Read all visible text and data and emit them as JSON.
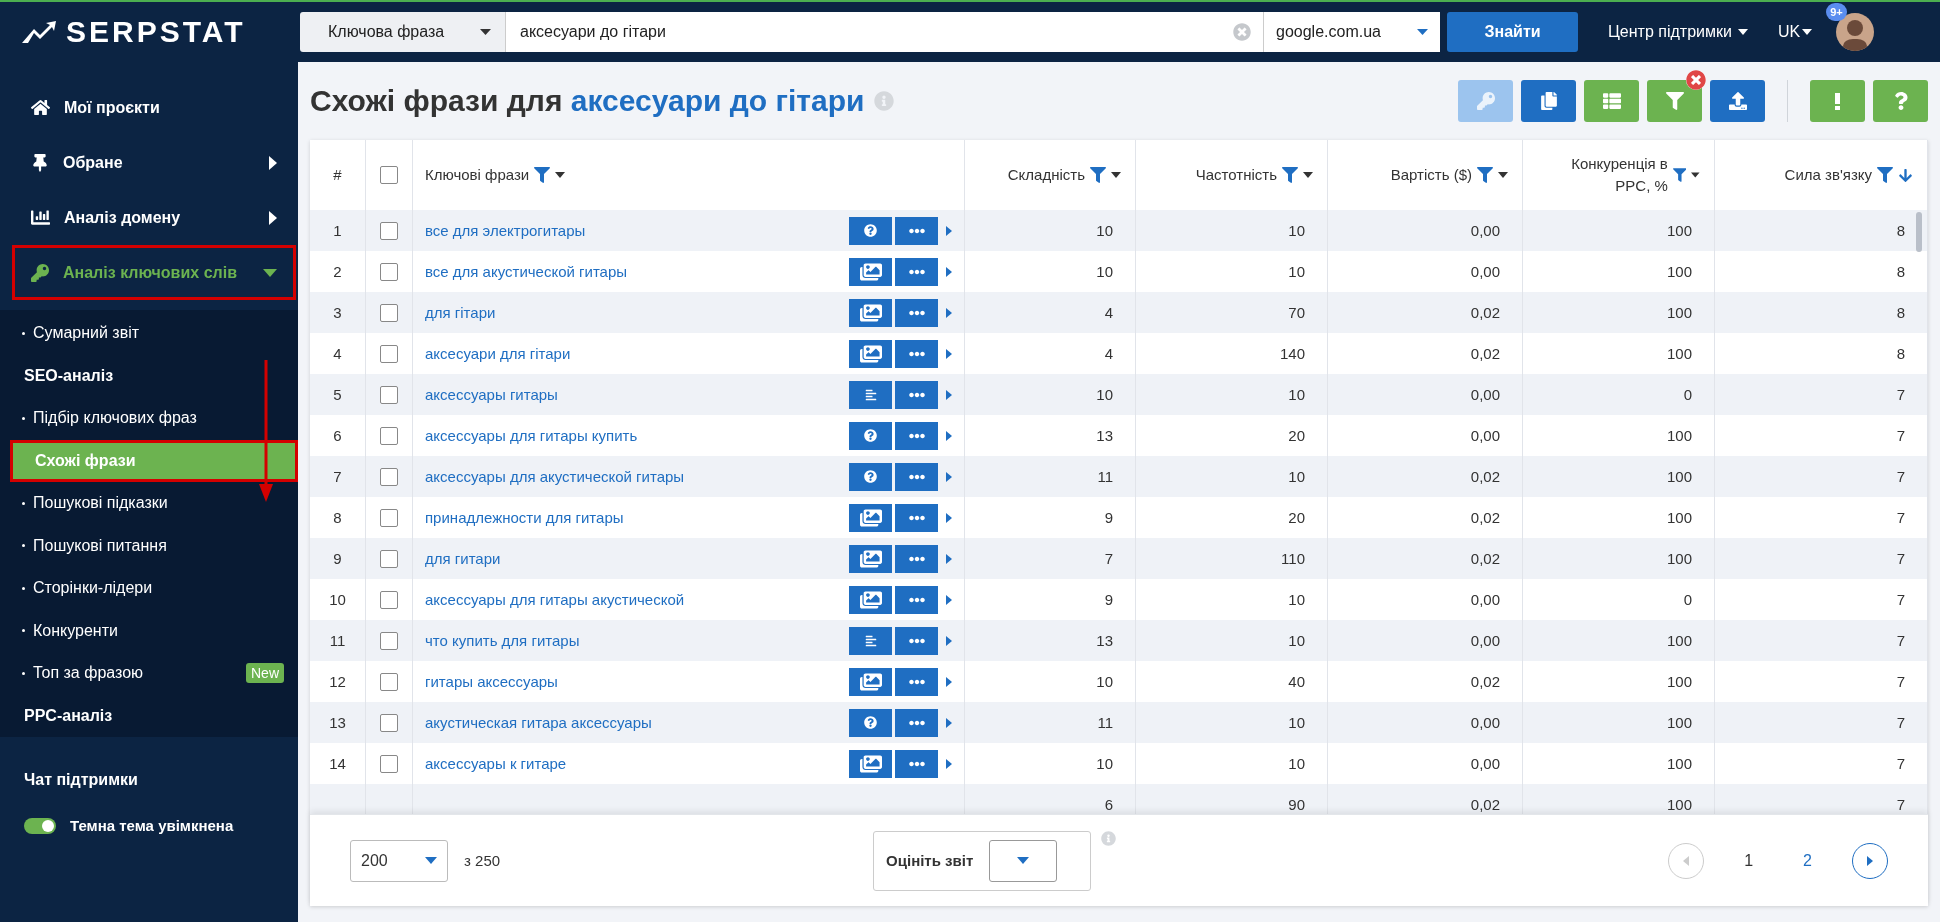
{
  "logo": {
    "text": "SERPSTAT"
  },
  "search": {
    "type_select": "Ключова фраза",
    "query": "аксесуари до гітари",
    "engine_select": "google.com.ua",
    "submit": "Знайти"
  },
  "header": {
    "support": "Центр підтримки",
    "language": "UK",
    "notifications": "9+"
  },
  "sidebar": {
    "items": [
      {
        "label": "Мої проєкти",
        "kind": "home",
        "submenu": false,
        "expanded": false,
        "annotated": false
      },
      {
        "label": "Обране",
        "kind": "pin",
        "submenu": true,
        "expanded": false,
        "annotated": false
      },
      {
        "label": "Аналіз домену",
        "kind": "chart",
        "submenu": true,
        "expanded": false,
        "annotated": false
      },
      {
        "label": "Аналіз ключових слів",
        "kind": "key",
        "submenu": true,
        "expanded": true,
        "annotated": true
      }
    ],
    "subitems": [
      {
        "label": "Сумарний звіт",
        "kind": "link",
        "selected": false,
        "annotated": false
      },
      {
        "label": "SEO-аналіз",
        "kind": "heading"
      },
      {
        "label": "Підбір ключових фраз",
        "kind": "link",
        "selected": false,
        "annotated": false
      },
      {
        "label": "Схожі фрази",
        "kind": "link",
        "selected": true,
        "annotated": true
      },
      {
        "label": "Пошукові підказки",
        "kind": "link",
        "selected": false,
        "annotated": false
      },
      {
        "label": "Пошукові питання",
        "kind": "link",
        "selected": false,
        "annotated": false
      },
      {
        "label": "Сторінки-лідери",
        "kind": "link",
        "selected": false,
        "annotated": false
      },
      {
        "label": "Конкуренти",
        "kind": "link",
        "selected": false,
        "annotated": false
      },
      {
        "label": "Топ за фразою",
        "kind": "link",
        "selected": false,
        "annotated": false,
        "badge": "New"
      },
      {
        "label": "PPC-аналіз",
        "kind": "heading"
      }
    ],
    "chat": "Чат підтримки",
    "theme_toggle": {
      "label": "Темна тема увімкнена",
      "on": true
    }
  },
  "page": {
    "title": "Схожі фрази для",
    "query": "аксесуари до гітари"
  },
  "toolbar": [
    {
      "kind": "key",
      "color": "#9cc4ee",
      "badge": false,
      "disabled": true
    },
    {
      "kind": "copy",
      "color": "#1f6ec2",
      "badge": false,
      "disabled": false
    },
    {
      "kind": "columns",
      "color": "#6cb350",
      "badge": false,
      "disabled": false
    },
    {
      "kind": "filter",
      "color": "#6cb350",
      "badge": true,
      "disabled": false
    },
    {
      "kind": "export",
      "color": "#1f6ec2",
      "badge": false,
      "disabled": false
    },
    {
      "kind": "feedback",
      "color": "#6cb350",
      "badge": false,
      "disabled": false
    },
    {
      "kind": "help",
      "color": "#6cb350",
      "badge": false,
      "disabled": false
    }
  ],
  "table": {
    "all_checked": false,
    "columns": [
      {
        "label": "#",
        "kind": "index"
      },
      {
        "kind": "check"
      },
      {
        "label": "Ключові фрази",
        "kind": "keyword",
        "filter": true,
        "sorted": false
      },
      {
        "label": "Складність",
        "kind": "num",
        "filter": true,
        "sorted": false
      },
      {
        "label": "Частотність",
        "kind": "num",
        "filter": true,
        "sorted": false
      },
      {
        "label": "Вартість ($)",
        "kind": "num",
        "filter": true,
        "sorted": false
      },
      {
        "label": "Конкуренція в PPC, %",
        "kind": "num",
        "filter": true,
        "sorted": false
      },
      {
        "label": "Сила зв'язку",
        "kind": "num",
        "filter": true,
        "sorted": true
      }
    ],
    "rows": [
      {
        "index": "1",
        "checked": false,
        "keyword": "все для электрогитары",
        "serp_button": {
          "kind": "question"
        },
        "values": [
          "10",
          "10",
          "0,00",
          "100",
          "8"
        ]
      },
      {
        "index": "2",
        "checked": false,
        "keyword": "все для акустической гитары",
        "serp_button": {
          "kind": "image"
        },
        "values": [
          "10",
          "10",
          "0,00",
          "100",
          "8"
        ]
      },
      {
        "index": "3",
        "checked": false,
        "keyword": "для гітари",
        "serp_button": {
          "kind": "image"
        },
        "values": [
          "4",
          "70",
          "0,02",
          "100",
          "8"
        ]
      },
      {
        "index": "4",
        "checked": false,
        "keyword": "аксесуари для гітари",
        "serp_button": {
          "kind": "image"
        },
        "values": [
          "4",
          "140",
          "0,02",
          "100",
          "8"
        ]
      },
      {
        "index": "5",
        "checked": false,
        "keyword": "аксессуары гитары",
        "serp_button": {
          "kind": "text"
        },
        "values": [
          "10",
          "10",
          "0,00",
          "0",
          "7"
        ]
      },
      {
        "index": "6",
        "checked": false,
        "keyword": "аксессуары для гитары купить",
        "serp_button": {
          "kind": "question"
        },
        "values": [
          "13",
          "20",
          "0,00",
          "100",
          "7"
        ]
      },
      {
        "index": "7",
        "checked": false,
        "keyword": "аксессуары для акустической гитары",
        "serp_button": {
          "kind": "question"
        },
        "values": [
          "11",
          "10",
          "0,02",
          "100",
          "7"
        ]
      },
      {
        "index": "8",
        "checked": false,
        "keyword": "принадлежности для гитары",
        "serp_button": {
          "kind": "image"
        },
        "values": [
          "9",
          "20",
          "0,02",
          "100",
          "7"
        ]
      },
      {
        "index": "9",
        "checked": false,
        "keyword": "для гитари",
        "serp_button": {
          "kind": "image"
        },
        "values": [
          "7",
          "110",
          "0,02",
          "100",
          "7"
        ]
      },
      {
        "index": "10",
        "checked": false,
        "keyword": "аксессуары для гитары акустической",
        "serp_button": {
          "kind": "image"
        },
        "values": [
          "9",
          "10",
          "0,00",
          "0",
          "7"
        ]
      },
      {
        "index": "11",
        "checked": false,
        "keyword": "что купить для гитары",
        "serp_button": {
          "kind": "text"
        },
        "values": [
          "13",
          "10",
          "0,00",
          "100",
          "7"
        ]
      },
      {
        "index": "12",
        "checked": false,
        "keyword": "гитары аксессуары",
        "serp_button": {
          "kind": "image"
        },
        "values": [
          "10",
          "40",
          "0,02",
          "100",
          "7"
        ]
      },
      {
        "index": "13",
        "checked": false,
        "keyword": "акустическая гитара аксессуары",
        "serp_button": {
          "kind": "question"
        },
        "values": [
          "11",
          "10",
          "0,00",
          "100",
          "7"
        ]
      },
      {
        "index": "14",
        "checked": false,
        "keyword": "аксессуары к гитаре",
        "serp_button": {
          "kind": "image"
        },
        "values": [
          "10",
          "10",
          "0,00",
          "100",
          "7"
        ]
      },
      {
        "values": [
          "6",
          "90",
          "0,02",
          "100",
          "7"
        ]
      }
    ]
  },
  "footer": {
    "per_page": "200",
    "total": "з 250",
    "rating_label": "Оцініть звіт",
    "pages": [
      {
        "label": "1",
        "selected": true
      },
      {
        "label": "2",
        "selected": false
      }
    ],
    "prev_disabled": true,
    "next_disabled": false
  }
}
